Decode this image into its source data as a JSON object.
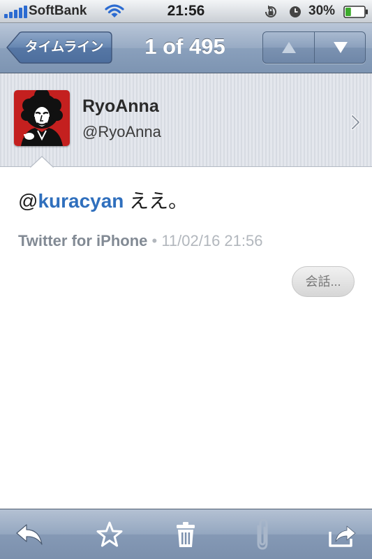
{
  "status_bar": {
    "carrier": "SoftBank",
    "time": "21:56",
    "battery_percent": "30%",
    "battery_level": 0.3
  },
  "nav": {
    "back_label": "タイムライン",
    "title": "1 of 495",
    "up_icon": "triangle-up-icon",
    "down_icon": "triangle-down-icon"
  },
  "profile": {
    "name": "RyoAnna",
    "handle": "@RyoAnna",
    "avatar_icon": "avatar-portrait"
  },
  "tweet": {
    "at": "@",
    "mention": "kuracyan",
    "body": " ええ。",
    "source": "Twitter for iPhone",
    "separator": " • ",
    "timestamp": "11/02/16 21:56",
    "conversation_label": "会話..."
  },
  "toolbar": {
    "items": [
      "reply-icon",
      "star-icon",
      "trash-icon",
      "paperclip-icon",
      "share-icon"
    ]
  },
  "colors": {
    "mention": "#2f6fbd",
    "nav_bar": "#8aa0bc",
    "avatar_bg": "#c4201f"
  }
}
